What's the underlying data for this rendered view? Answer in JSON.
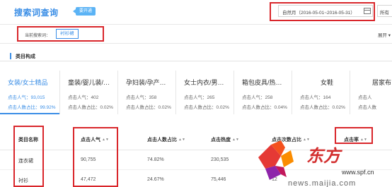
{
  "header": {
    "title": "搜索词查询",
    "badge": "要开通",
    "date_range": "自然月（2016-05-01~2016-05-31）",
    "other_select": "所有"
  },
  "search": {
    "label": "当前搜索词：",
    "keyword": "衬衫裙",
    "expand": "展开 ▾"
  },
  "section": {
    "title": "类目构成"
  },
  "categories": [
    {
      "name": "女装/女士精品",
      "line1": "点击人气：93,015",
      "line2": "点击人数占比：99.92%"
    },
    {
      "name": "童装/婴儿装/…",
      "line1": "点击人气：402",
      "line2": "点击人数占比：0.02%"
    },
    {
      "name": "孕妇装/孕产…",
      "line1": "点击人气：358",
      "line2": "点击人数占比：0.02%"
    },
    {
      "name": "女士内衣/男…",
      "line1": "点击人气：265",
      "line2": "点击人数占比：0.02%"
    },
    {
      "name": "箱包皮具/热…",
      "line1": "点击人气：258",
      "line2": "点击人数占比：0.04%"
    },
    {
      "name": "女鞋",
      "line1": "点击人气：164",
      "line2": "点击人数占比：0.02%"
    },
    {
      "name": "居家布",
      "line1": "点击人",
      "line2": "点击人数"
    }
  ],
  "table": {
    "headers": [
      "类目名称",
      "点击人气",
      "点击人数占比",
      "点击热度",
      "点击次数占比",
      "点击率"
    ],
    "rows": [
      [
        "连衣裙",
        "90,755",
        "74.82%",
        "230,535",
        ""
      ],
      [
        "衬衫",
        "47,472",
        "24.67%",
        "75,446",
        "12"
      ]
    ]
  },
  "colors": {
    "accent": "#3a8ee6",
    "highlight": "#d9262b"
  },
  "watermark": {
    "brand": "东方",
    "url_text": "www.spf.cn",
    "footer_text": "news.maijia.com"
  }
}
